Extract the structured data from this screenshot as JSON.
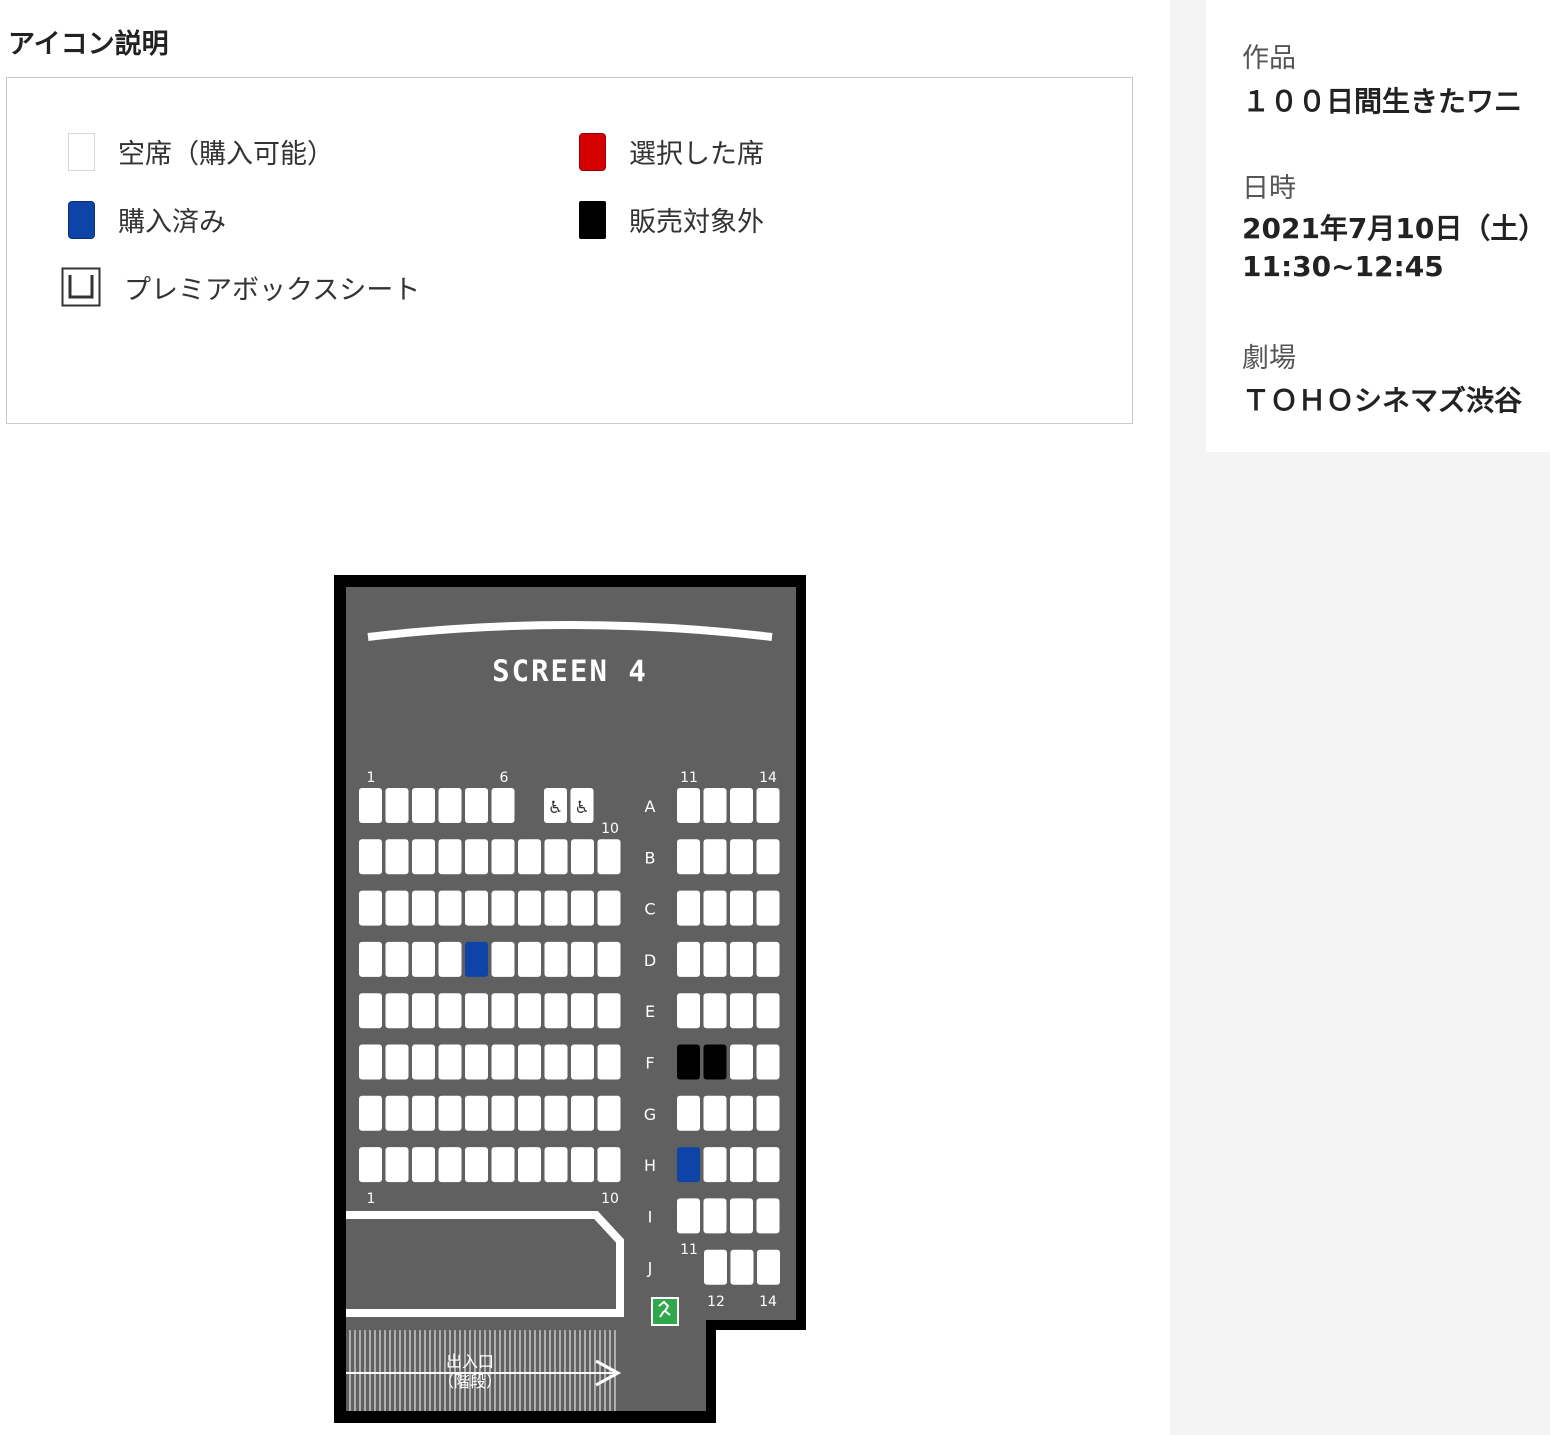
{
  "legend": {
    "title": "アイコン説明",
    "items": {
      "empty": "空席（購入可能）",
      "selected": "選択した席",
      "purchased": "購入済み",
      "unavailable": "販売対象外",
      "premier": "プレミアボックスシート"
    },
    "colors": {
      "selected": "#d60000",
      "purchased": "#0e44a8",
      "unavailable": "#000000",
      "empty": "#ffffff"
    }
  },
  "info": {
    "work_label": "作品",
    "work_value": "１００日間生きたワニ",
    "datetime_label": "日時",
    "date_value": "2021年7月10日（土）",
    "time_value": "11:30~12:45",
    "theater_label": "劇場",
    "theater_value": "ＴＯＨＯシネマズ渋谷"
  },
  "seatmap": {
    "screen_label": "SCREEN 4",
    "entrance_line1": "出入口",
    "entrance_line2": "（階段）",
    "col_labels_top_left": [
      "1",
      "6"
    ],
    "col_labels_top_right": [
      "11",
      "14"
    ],
    "col_label_a10": "10",
    "col_labels_bottom_left": [
      "1",
      "10"
    ],
    "col_label_j11": "11",
    "col_labels_j_right": [
      "12",
      "14"
    ],
    "rows": [
      "A",
      "B",
      "C",
      "D",
      "E",
      "F",
      "G",
      "H",
      "I",
      "J"
    ],
    "purchased_seats": [
      "D5",
      "H11"
    ],
    "unavailable_seats": [
      "F11",
      "F12"
    ],
    "wheelchair_seats": [
      "A9",
      "A10"
    ],
    "colors": {
      "floor": "#606060",
      "wall": "#000000",
      "seat": "#ffffff",
      "exit": "#2ea84a"
    }
  }
}
